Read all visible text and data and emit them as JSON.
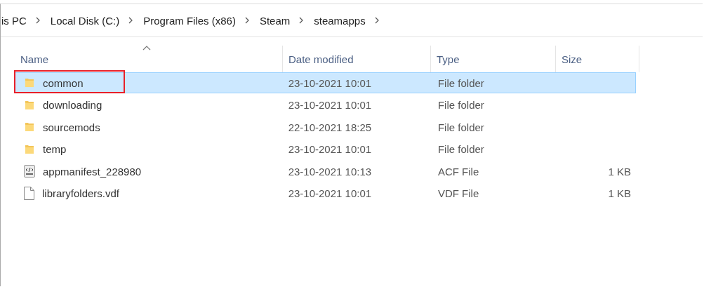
{
  "breadcrumb": [
    "is PC",
    "Local Disk (C:)",
    "Program Files (x86)",
    "Steam",
    "steamapps"
  ],
  "columns": [
    {
      "label": "Name",
      "sorted": true
    },
    {
      "label": "Date modified",
      "sorted": false
    },
    {
      "label": "Type",
      "sorted": false
    },
    {
      "label": "Size",
      "sorted": false
    }
  ],
  "rows": [
    {
      "kind": "folder",
      "name": "common",
      "date": "23-10-2021 10:01",
      "type": "File folder",
      "size": "",
      "selected": true,
      "outlined": true
    },
    {
      "kind": "folder",
      "name": "downloading",
      "date": "23-10-2021 10:01",
      "type": "File folder",
      "size": "",
      "selected": false,
      "outlined": false
    },
    {
      "kind": "folder",
      "name": "sourcemods",
      "date": "22-10-2021 18:25",
      "type": "File folder",
      "size": "",
      "selected": false,
      "outlined": false
    },
    {
      "kind": "folder",
      "name": "temp",
      "date": "23-10-2021 10:01",
      "type": "File folder",
      "size": "",
      "selected": false,
      "outlined": false
    },
    {
      "kind": "code",
      "name": "appmanifest_228980",
      "date": "23-10-2021 10:13",
      "type": "ACF File",
      "size": "1 KB",
      "selected": false,
      "outlined": false
    },
    {
      "kind": "file",
      "name": "libraryfolders.vdf",
      "date": "23-10-2021 10:01",
      "type": "VDF File",
      "size": "1 KB",
      "selected": false,
      "outlined": false
    }
  ]
}
